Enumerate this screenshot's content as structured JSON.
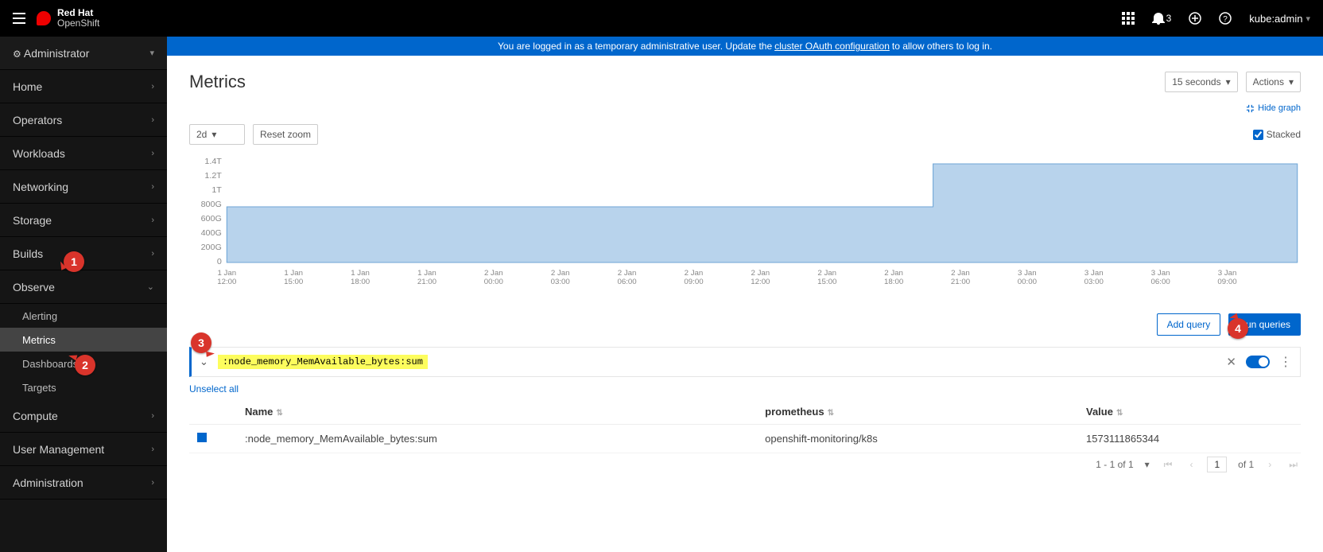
{
  "topbar": {
    "brand_l1": "Red Hat",
    "brand_l2": "OpenShift",
    "bell_count": "3",
    "user": "kube:admin"
  },
  "banner": {
    "prefix": "You are logged in as a temporary administrative user. Update the ",
    "link": "cluster OAuth configuration",
    "suffix": " to allow others to log in."
  },
  "sidebar": {
    "perspective": "Administrator",
    "items": [
      {
        "label": "Home"
      },
      {
        "label": "Operators"
      },
      {
        "label": "Workloads"
      },
      {
        "label": "Networking"
      },
      {
        "label": "Storage"
      },
      {
        "label": "Builds"
      },
      {
        "label": "Observe",
        "expanded": true,
        "children": [
          {
            "label": "Alerting"
          },
          {
            "label": "Metrics",
            "selected": true
          },
          {
            "label": "Dashboards"
          },
          {
            "label": "Targets"
          }
        ]
      },
      {
        "label": "Compute"
      },
      {
        "label": "User Management"
      },
      {
        "label": "Administration"
      }
    ]
  },
  "page": {
    "title": "Metrics",
    "refresh": "15 seconds",
    "actions": "Actions",
    "hide_graph": "Hide graph",
    "time_range": "2d",
    "reset_zoom": "Reset zoom",
    "stacked_label": "Stacked",
    "add_query": "Add query",
    "run_queries": "Run queries",
    "query_text": ":node_memory_MemAvailable_bytes:sum",
    "unselect": "Unselect all",
    "columns": {
      "name": "Name",
      "prometheus": "prometheus",
      "value": "Value"
    },
    "row": {
      "name": ":node_memory_MemAvailable_bytes:sum",
      "prometheus": "openshift-monitoring/k8s",
      "value": "1573111865344"
    },
    "pager_range": "1 - 1 of 1",
    "pager_page": "1",
    "pager_of": "of 1"
  },
  "chart_data": {
    "type": "area",
    "ylabel": "",
    "ylim_bytes": [
      0,
      1400000000000
    ],
    "y_ticks": [
      "0",
      "200G",
      "400G",
      "600G",
      "800G",
      "1T",
      "1.2T",
      "1.4T"
    ],
    "x_ticks": [
      "1 Jan 12:00",
      "1 Jan 15:00",
      "1 Jan 18:00",
      "1 Jan 21:00",
      "2 Jan 00:00",
      "2 Jan 03:00",
      "2 Jan 06:00",
      "2 Jan 09:00",
      "2 Jan 12:00",
      "2 Jan 15:00",
      "2 Jan 18:00",
      "2 Jan 21:00",
      "3 Jan 00:00",
      "3 Jan 03:00",
      "3 Jan 06:00",
      "3 Jan 09:00"
    ],
    "series": [
      {
        "name": ":node_memory_MemAvailable_bytes:sum",
        "color": "#a6c8e6",
        "points_bytes": [
          [
            "1 Jan 12:00",
            800000000000
          ],
          [
            "2 Jan 18:00",
            800000000000
          ],
          [
            "2 Jan 18:15",
            1400000000000
          ],
          [
            "3 Jan 09:00",
            1400000000000
          ]
        ]
      }
    ]
  },
  "annotations": {
    "1": "1",
    "2": "2",
    "3": "3",
    "4": "4"
  }
}
